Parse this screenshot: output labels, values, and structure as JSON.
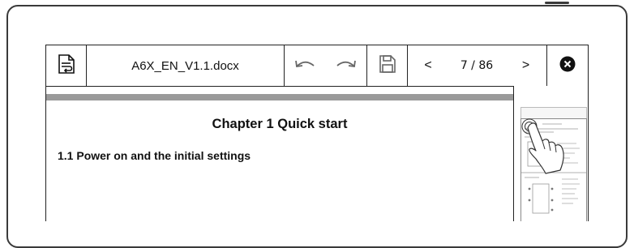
{
  "toolbar": {
    "doc_title": "A6X_EN_V1.1.docx",
    "page_indicator": "7 / 86",
    "prev_label": "<",
    "next_label": ">"
  },
  "document": {
    "chapter_title": "Chapter 1 Quick start",
    "section_title": "1.1 Power on and the initial settings"
  },
  "icons": {
    "format": "reflow-icon",
    "undo": "undo-icon",
    "redo": "redo-icon",
    "save": "save-icon",
    "close": "close-icon"
  }
}
